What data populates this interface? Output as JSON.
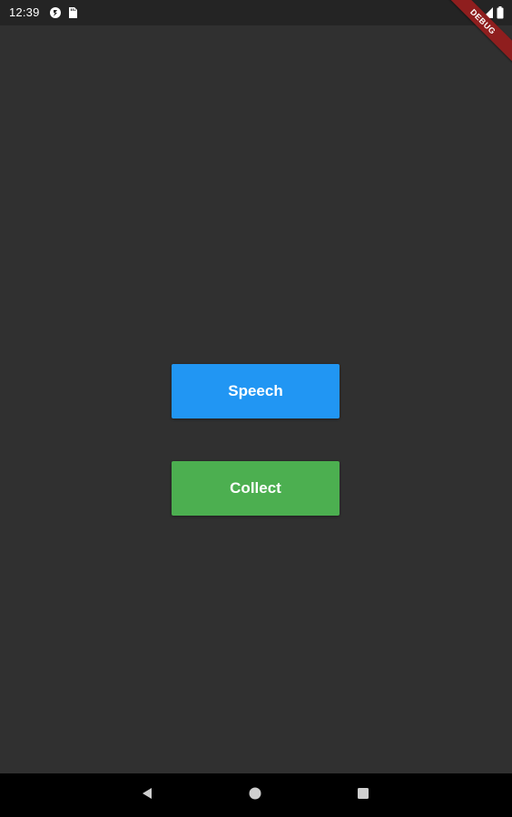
{
  "status_bar": {
    "time": "12:39",
    "left_icons": [
      "app-notification-icon",
      "sd-card-icon"
    ],
    "right_icons": [
      "wifi-icon",
      "signal-icon",
      "battery-icon"
    ]
  },
  "debug_banner": {
    "label": "DEBUG",
    "color": "#8f1e1e"
  },
  "main": {
    "background": "#303030",
    "speech_button": {
      "label": "Speech",
      "color": "#2196f3"
    },
    "collect_button": {
      "label": "Collect",
      "color": "#4caf50"
    }
  },
  "nav_bar": {
    "buttons": [
      "back-icon",
      "home-icon",
      "recents-icon"
    ]
  }
}
